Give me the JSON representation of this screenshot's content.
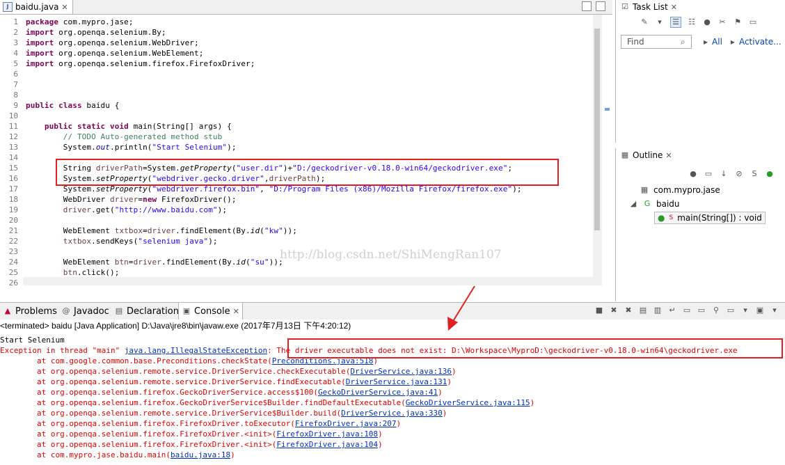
{
  "editor": {
    "tab_title": "baidu.java",
    "lines": [
      {
        "n": "1",
        "html": "<span class='kw'>package</span> com.mypro.jase;"
      },
      {
        "n": "2",
        "html": "<span class='kw'>import</span> org.openqa.selenium.By;"
      },
      {
        "n": "3",
        "html": "<span class='kw'>import</span> org.openqa.selenium.WebDriver;"
      },
      {
        "n": "4",
        "html": "<span class='kw'>import</span> org.openqa.selenium.WebElement;"
      },
      {
        "n": "5",
        "html": "<span class='kw'>import</span> org.openqa.selenium.firefox.FirefoxDriver;"
      },
      {
        "n": "6",
        "html": ""
      },
      {
        "n": "7",
        "html": ""
      },
      {
        "n": "8",
        "html": ""
      },
      {
        "n": "9",
        "html": "<span class='kw'>public class</span> baidu {"
      },
      {
        "n": "10",
        "html": ""
      },
      {
        "n": "11",
        "html": "    <span class='kw'>public static void</span> main(String[] args) {"
      },
      {
        "n": "12",
        "html": "        <span class='cmt'>// TODO Auto-generated method stub</span>"
      },
      {
        "n": "13",
        "html": "        System.<span class='fld'>out</span>.println(<span class='str'>\"Start Selenium\"</span>);"
      },
      {
        "n": "14",
        "html": ""
      },
      {
        "n": "15",
        "html": "        String <span class='var'>driverPath</span>=System.<span class='it'>getProperty</span>(<span class='str'>\"user.dir\"</span>)+<span class='str'>\"D:/geckodriver-v0.18.0-win64/geckodriver.exe\"</span>;"
      },
      {
        "n": "16",
        "html": "        System.<span class='it'>setProperty</span>(<span class='str'>\"webdriver.gecko.driver\"</span>,<span class='var'>driverPath</span>);"
      },
      {
        "n": "17",
        "html": "        System.<span class='it'>setProperty</span>(<span class='str'>\"webdriver.firefox.bin\"</span>, <span class='str'>\"D:/Program Files (x86)/Mozilla Firefox/firefox.exe\"</span>);"
      },
      {
        "n": "18",
        "html": "        WebDriver <span class='var'>driver</span>=<span class='kw'>new</span> FirefoxDriver();"
      },
      {
        "n": "19",
        "html": "        <span class='var'>driver</span>.get(<span class='str'>\"http://www.baidu.com\"</span>);"
      },
      {
        "n": "20",
        "html": ""
      },
      {
        "n": "21",
        "html": "        WebElement <span class='var'>txtbox</span>=<span class='var'>driver</span>.findElement(By.<span class='it'>id</span>(<span class='str'>\"kw\"</span>));"
      },
      {
        "n": "22",
        "html": "        <span class='var'>txtbox</span>.sendKeys(<span class='str'>\"selenium java\"</span>);"
      },
      {
        "n": "23",
        "html": ""
      },
      {
        "n": "24",
        "html": "        WebElement <span class='var'>btn</span>=<span class='var'>driver</span>.findElement(By.<span class='it'>id</span>(<span class='str'>\"su\"</span>));"
      },
      {
        "n": "25",
        "html": "        <span class='var'>btn</span>.click();"
      },
      {
        "n": "26",
        "html": ""
      }
    ],
    "watermark": "http://blog.csdn.net/ShiMengRan107"
  },
  "task_list": {
    "title": "Task List",
    "find_placeholder": "Find",
    "all_label": "All",
    "activate_label": "Activate..."
  },
  "outline": {
    "title": "Outline",
    "package": "com.mypro.jase",
    "class": "baidu",
    "method": "main(String[]) : void"
  },
  "bottom_tabs": [
    "Problems",
    "Javadoc",
    "Declaration",
    "Console"
  ],
  "console": {
    "header": "<terminated> baidu [Java Application] D:\\Java\\jre8\\bin\\javaw.exe (2017年7月13日 下午4:20:12)",
    "start": "Start Selenium",
    "exception_prefix": "Exception in thread \"main\" ",
    "exception_class": "java.lang.IllegalStateException",
    "exception_msg": ": The driver executable does not exist: D:\\Workspace\\MyproD:\\geckodriver-v0.18.0-win64\\geckodriver.exe",
    "stack": [
      {
        "at": "        at com.google.common.base.Preconditions.checkState(",
        "link": "Preconditions.java:518",
        "end": ")"
      },
      {
        "at": "        at org.openqa.selenium.remote.service.DriverService.checkExecutable(",
        "link": "DriverService.java:136",
        "end": ")"
      },
      {
        "at": "        at org.openqa.selenium.remote.service.DriverService.findExecutable(",
        "link": "DriverService.java:131",
        "end": ")"
      },
      {
        "at": "        at org.openqa.selenium.firefox.GeckoDriverService.access$100(",
        "link": "GeckoDriverService.java:41",
        "end": ")"
      },
      {
        "at": "        at org.openqa.selenium.firefox.GeckoDriverService$Builder.findDefaultExecutable(",
        "link": "GeckoDriverService.java:115",
        "end": ")"
      },
      {
        "at": "        at org.openqa.selenium.remote.service.DriverService$Builder.build(",
        "link": "DriverService.java:330",
        "end": ")"
      },
      {
        "at": "        at org.openqa.selenium.firefox.FirefoxDriver.toExecutor(",
        "link": "FirefoxDriver.java:207",
        "end": ")"
      },
      {
        "at": "        at org.openqa.selenium.firefox.FirefoxDriver.<init>(",
        "link": "FirefoxDriver.java:108",
        "end": ")"
      },
      {
        "at": "        at org.openqa.selenium.firefox.FirefoxDriver.<init>(",
        "link": "FirefoxDriver.java:104",
        "end": ")"
      },
      {
        "at": "        at com.mypro.jase.baidu.main(",
        "link": "baidu.java:18",
        "end": ")"
      }
    ]
  },
  "colors": {
    "highlight": "#e02020",
    "keyword": "#7f0055",
    "string": "#2a00ff",
    "error": "#e00000",
    "link": "#0030c0"
  }
}
